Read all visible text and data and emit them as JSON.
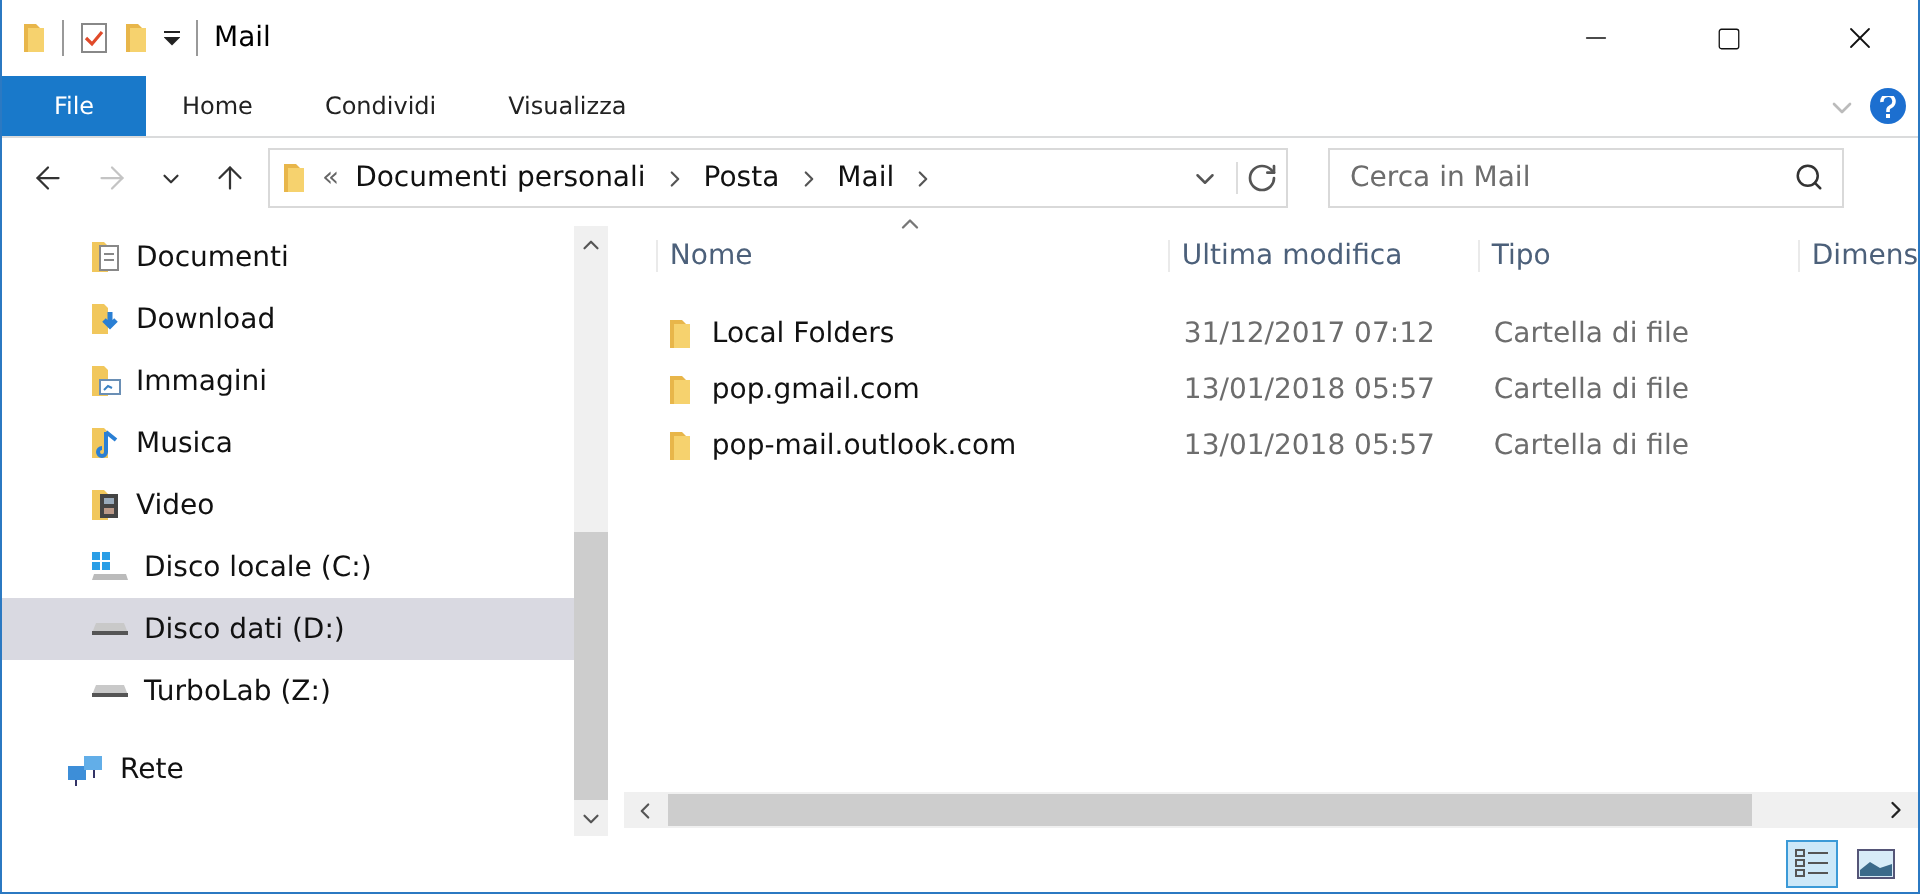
{
  "window": {
    "title": "Mail"
  },
  "ribbon_tabs": [
    {
      "label": "File",
      "selected": true
    },
    {
      "label": "Home",
      "selected": false
    },
    {
      "label": "Condividi",
      "selected": false
    },
    {
      "label": "Visualizza",
      "selected": false
    }
  ],
  "address": {
    "overflow": "«",
    "path": [
      "Documenti personali",
      "Posta",
      "Mail"
    ]
  },
  "search": {
    "placeholder": "Cerca in Mail"
  },
  "nav_items": [
    {
      "label": "Documenti",
      "kind": "documents",
      "selected": false
    },
    {
      "label": "Download",
      "kind": "downloads",
      "selected": false
    },
    {
      "label": "Immagini",
      "kind": "pictures",
      "selected": false
    },
    {
      "label": "Musica",
      "kind": "music",
      "selected": false
    },
    {
      "label": "Video",
      "kind": "videos",
      "selected": false
    },
    {
      "label": "Disco locale (C:)",
      "kind": "system-drive",
      "selected": false
    },
    {
      "label": "Disco dati (D:)",
      "kind": "drive",
      "selected": true
    },
    {
      "label": "TurboLab (Z:)",
      "kind": "drive",
      "selected": false
    },
    {
      "label": "Rete",
      "kind": "network",
      "selected": false
    }
  ],
  "columns": [
    "Nome",
    "Ultima modifica",
    "Tipo",
    "Dimens"
  ],
  "rows": [
    {
      "name": "Local Folders",
      "modified": "31/12/2017 07:12",
      "type": "Cartella di file"
    },
    {
      "name": "pop.gmail.com",
      "modified": "13/01/2018 05:57",
      "type": "Cartella di file"
    },
    {
      "name": "pop-mail.outlook.com",
      "modified": "13/01/2018 05:57",
      "type": "Cartella di file"
    }
  ],
  "view_buttons": [
    {
      "kind": "details",
      "selected": true
    },
    {
      "kind": "large-icons",
      "selected": false
    }
  ]
}
